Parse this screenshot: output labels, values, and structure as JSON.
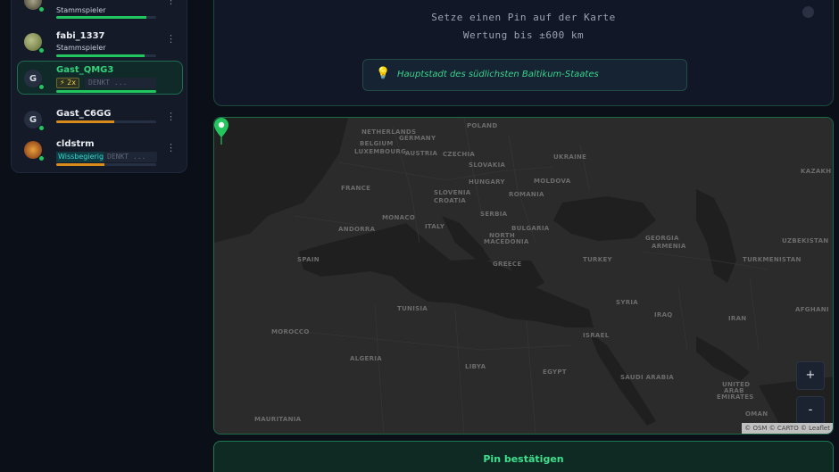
{
  "players": [
    {
      "name": "",
      "tag": "Stammspieler",
      "bar": 0.9,
      "bar_color": "green",
      "avatar": "image"
    },
    {
      "name": "fabi_1337",
      "tag": "Stammspieler",
      "bar": 0.88,
      "bar_color": "green",
      "avatar": "image"
    },
    {
      "name": "Gast_QMG3",
      "avatar_letter": "G",
      "streak": "⚡ 2x",
      "thinking": "DENKT ...",
      "bar": 1.0,
      "bar_color": "green",
      "active": true
    },
    {
      "name": "Gast_C6GG",
      "avatar_letter": "G",
      "bar": 0.58,
      "bar_color": "orange"
    },
    {
      "name": "cldstrm",
      "tag": "Wissbegierig",
      "thinking": "DENKT ...",
      "bar": 0.48,
      "bar_color": "orange",
      "avatar": "image"
    }
  ],
  "instruction": {
    "line1": "Setze einen Pin auf der Karte",
    "line2": "Wertung bis ±600 km"
  },
  "hint": {
    "icon": "lightbulb-icon",
    "text": "Hauptstadt des südlichsten Baltikum-Staates"
  },
  "map": {
    "labels": {
      "poland": "POLAND",
      "netherlands": "NETHERLANDS",
      "germany": "GERMANY",
      "belgium": "BELGIUM",
      "luxembourg": "LUXEMBOURG",
      "czechia": "CZECHIA",
      "slovakia": "SLOVAKIA",
      "ukraine": "UKRAINE",
      "austria": "AUSTRIA",
      "hungary": "HUNGARY",
      "moldova": "MOLDOVA",
      "france": "FRANCE",
      "slovenia": "SLOVENIA",
      "croatia": "CROATIA",
      "romania": "ROMANIA",
      "serbia": "SERBIA",
      "monaco": "MONACO",
      "italy": "ITALY",
      "andorra": "ANDORRA",
      "bulgaria": "BULGARIA",
      "north": "NORTH",
      "macedonia": "MACEDONIA",
      "georgia": "GEORGIA",
      "armenia": "ARMENIA",
      "uzbekistan": "UZBEKISTAN",
      "kazakh": "KAZAKH",
      "spain": "SPAIN",
      "greece": "GREECE",
      "turkey": "TURKEY",
      "turkmenistan": "TURKMENISTAN",
      "tunisia": "TUNISIA",
      "syria": "SYRIA",
      "iraq": "IRAQ",
      "iran": "IRAN",
      "afghan": "AFGHANI",
      "morocco": "MOROCCO",
      "israel": "ISRAEL",
      "algeria": "ALGERIA",
      "libya": "LIBYA",
      "egypt": "EGYPT",
      "saudi": "SAUDI ARABIA",
      "uae1": "UNITED",
      "uae2": "ARAB",
      "uae3": "EMIRATES",
      "oman": "OMAN",
      "mauritania": "MAURITANIA"
    },
    "zoom_in": "+",
    "zoom_out": "-",
    "attribution": "© OSM © CARTO © Leaflet"
  },
  "confirm_label": "Pin bestätigen",
  "colors": {
    "accent": "#34d27b",
    "streak": "#f2c94c",
    "orange": "#d98b1c"
  }
}
